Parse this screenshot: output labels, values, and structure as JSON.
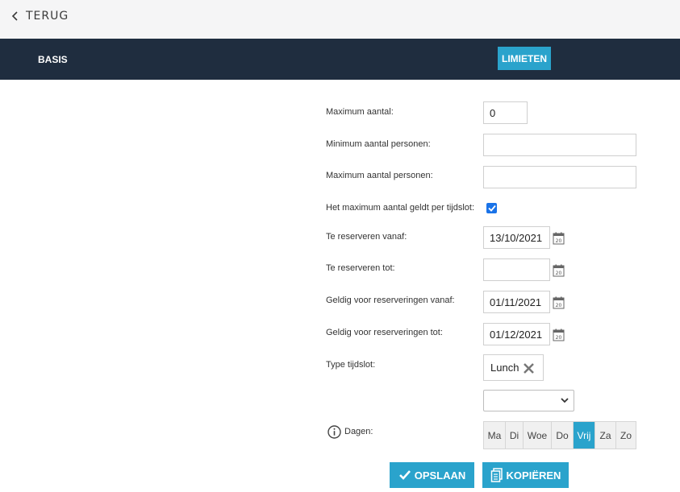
{
  "back": {
    "label": "TERUG"
  },
  "nav": {
    "basis": "BASIS",
    "limieten": "LIMIETEN"
  },
  "form": {
    "max_aantal": {
      "label": "Maximum aantal:",
      "value": "0"
    },
    "min_personen": {
      "label": "Minimum aantal personen:",
      "value": ""
    },
    "max_personen": {
      "label": "Maximum aantal personen:",
      "value": ""
    },
    "per_tijdslot": {
      "label": "Het maximum aantal geldt per tijdslot:",
      "checked": true
    },
    "reserveren_vanaf": {
      "label": "Te reserveren vanaf:",
      "value": "13/10/2021"
    },
    "reserveren_tot": {
      "label": "Te reserveren tot:",
      "value": ""
    },
    "geldig_vanaf": {
      "label": "Geldig voor reserveringen vanaf:",
      "value": "01/11/2021"
    },
    "geldig_tot": {
      "label": "Geldig voor reserveringen tot:",
      "value": "01/12/2021"
    },
    "type_tijdslot": {
      "label": "Type tijdslot:",
      "chip": "Lunch",
      "select_value": ""
    },
    "dagen": {
      "label": "Dagen:",
      "days": [
        "Ma",
        "Di",
        "Woe",
        "Do",
        "Vrij",
        "Za",
        "Zo"
      ],
      "active": "Vrij"
    }
  },
  "actions": {
    "save": "OPSLAAN",
    "copy": "KOPIËREN"
  },
  "colors": {
    "accent": "#2aa3cc",
    "navbar": "#1f2d3f",
    "checkbox": "#1a73e8"
  },
  "icons": [
    "chevron-left-icon",
    "calendar-icon",
    "close-icon",
    "chevron-down-icon",
    "info-icon",
    "check-icon",
    "copy-icon"
  ]
}
